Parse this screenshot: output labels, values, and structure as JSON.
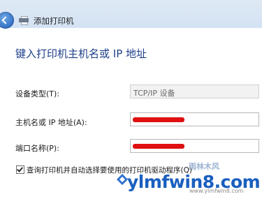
{
  "window": {
    "title": "添加打印机",
    "back_icon": "back-arrow-icon",
    "title_icon": "printer-icon"
  },
  "page": {
    "heading": "键入打印机主机名或 IP 地址"
  },
  "form": {
    "device_type_label": "设备类型(T):",
    "device_type_value": "TCP/IP 设备",
    "hostname_label": "主机名或 IP 地址(A):",
    "hostname_value": "",
    "port_label": "端口名称(P):",
    "port_value": "",
    "query_checkbox_label": "查询打印机并自动选择要使用的打印机驱动程序(Q)",
    "query_checked": true
  },
  "watermark": {
    "brand": "ylmfwin8.com",
    "site": "雨林木风",
    "url": "www.ylmfwin8.com"
  },
  "colors": {
    "heading": "#1d3f8a",
    "titlebar": "#dfe9f5",
    "redaction": "#e01010",
    "watermark": "#1a5fc0"
  }
}
